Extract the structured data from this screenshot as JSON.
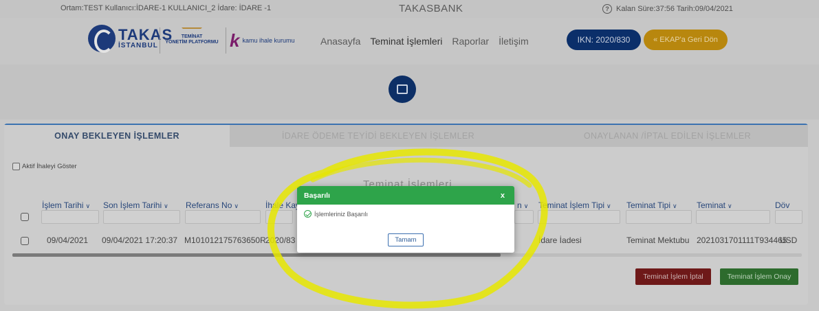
{
  "topbar": {
    "environment": "Ortam:TEST  Kullanıcı:İDARE-1 KULLANICI_2  İdare: İDARE -1",
    "brand": "TAKASBANK",
    "session": "Kalan Süre:37:56  Tarih:09/04/2021"
  },
  "logos": {
    "takas_big": "TAKAS",
    "takas_small": "İSTANBUL",
    "teminat_line1": "TEMİNAT",
    "teminat_line2": "YÖNETİM PLATFORMU",
    "kik_letter": "k",
    "kik_text": "kamu ihale kurumu"
  },
  "nav": {
    "items": [
      "Anasayfa",
      "Teminat İşlemleri",
      "Raporlar",
      "İletişim"
    ],
    "ikn": "IKN: 2020/830",
    "ekap": "« EKAP'a Geri Dön"
  },
  "tabs": [
    "ONAY BEKLEYEN İŞLEMLER",
    "İDARE ÖDEME TEYİDİ BEKLEYEN İŞLEMLER",
    "ONAYLANAN /İPTAL EDİLEN İŞLEMLER"
  ],
  "aktif_label": "Aktif İhaleyi Göster",
  "table": {
    "title": "Teminat İşlemleri",
    "headers": [
      "İşlem Tarihi",
      "Son İşlem Tarihi",
      "Referans No",
      "İhale Kayıt",
      "n",
      "Teminat İşlem Tipi",
      "Teminat Tipi",
      "Teminat",
      "Döv"
    ],
    "row": [
      "09/04/2021",
      "09/04/2021 17:20:37",
      "M101012175763650R",
      "2020/83",
      "İdare İadesi",
      "Teminat Mektubu",
      "2021031701111T934465",
      "USD"
    ]
  },
  "actions": {
    "cancel": "Teminat İşlem İptal",
    "approve": "Teminat İşlem Onay"
  },
  "modal": {
    "title": "Başarılı",
    "close": "x",
    "message": "İşlemleriniz Başarılı",
    "ok": "Tamam"
  },
  "colors": {
    "modal_header": "#2ea44a",
    "ikn_badge": "#0b2f6a",
    "ekap_button": "#b8870e",
    "cancel_button": "#6e1919",
    "approve_button": "#2d6b2d",
    "annotation": "#e6e600"
  }
}
